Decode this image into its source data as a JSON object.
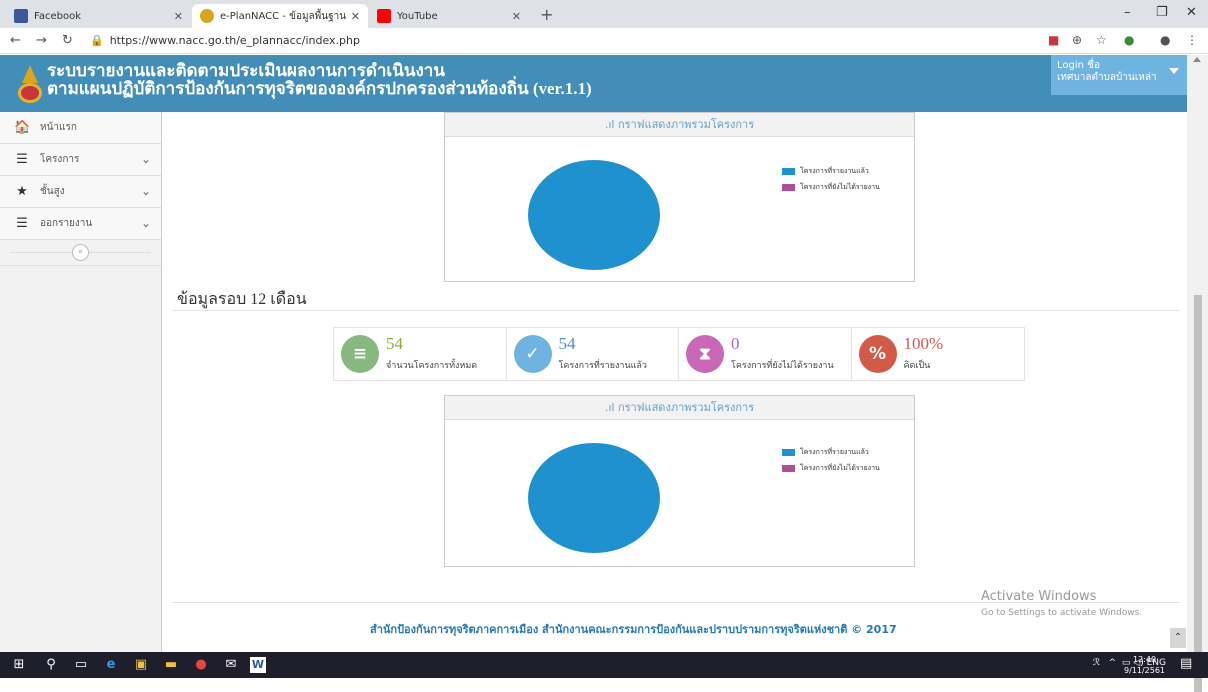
{
  "browser": {
    "tabs": [
      {
        "title": "Facebook",
        "favicon": "facebook-icon",
        "color": "#3b5998"
      },
      {
        "title": "e-PlanNACC - ข้อมูลพื้นฐาน",
        "favicon": "nacc-logo-icon",
        "color": "#d9a520"
      },
      {
        "title": "YouTube",
        "favicon": "youtube-icon",
        "color": "#ff0000"
      }
    ],
    "url": "https://www.nacc.go.th/e_plannacc/index.php",
    "new_tab": "+"
  },
  "header": {
    "title_line1": "ระบบรายงานและติดตามประเมินผลงานการดำเนินงาน",
    "title_line2": "ตามแผนปฏิบัติการป้องกันการทุจริตขององค์กรปกครองส่วนท้องถิ่น (ver.1.1)",
    "login_label": "Login ชื่อ",
    "login_user": "เทศบาลตำบลบ้านเหล่า",
    "color": "#438eb9"
  },
  "sidebar": {
    "items": [
      {
        "label": "หน้าแรก",
        "icon": "home-icon",
        "expandable": false
      },
      {
        "label": "โครงการ",
        "icon": "list-icon",
        "expandable": true
      },
      {
        "label": "ชั้นสูง",
        "icon": "star-icon",
        "expandable": true
      },
      {
        "label": "ออกรายงาน",
        "icon": "list-icon",
        "expandable": true
      }
    ],
    "collapse": "«"
  },
  "chart_widget_1": {
    "heading": "กราฟแสดงภาพรวมโครงการ"
  },
  "section": {
    "title": "ข้อมูลรอบ 12 เดือน"
  },
  "stats": [
    {
      "value": "54",
      "label": "จำนวนโครงการทั้งหมด",
      "icon": "database-icon",
      "color": "#87b87f",
      "numcolor": "#8bac3f"
    },
    {
      "value": "54",
      "label": "โครงการที่รายงานแล้ว",
      "icon": "check-icon",
      "color": "#6fb3e0",
      "numcolor": "#478fca"
    },
    {
      "value": "0",
      "label": "โครงการที่ยังไม่ได้รายงาน",
      "icon": "hourglass-icon",
      "color": "#c868b7",
      "numcolor": "#a069c3"
    },
    {
      "value": "100%",
      "label": "คิดเป็น",
      "icon": "percent-icon",
      "color": "#d15b47",
      "numcolor": "#d15b47"
    }
  ],
  "chart_widget_2": {
    "heading": "กราฟแสดงภาพรวมโครงการ"
  },
  "chart_data": [
    {
      "type": "pie",
      "title": "กราฟแสดงภาพรวมโครงการ",
      "categories": [
        "โครงการที่รายงานแล้ว",
        "โครงการที่ยังไม่ได้รายงาน"
      ],
      "values": [
        54,
        0
      ],
      "colors": [
        "#2091cf",
        "#af4e96"
      ],
      "legend": "top-right"
    },
    {
      "type": "pie",
      "title": "กราฟแสดงภาพรวมโครงการ",
      "categories": [
        "โครงการที่รายงานแล้ว",
        "โครงการที่ยังไม่ได้รายงาน"
      ],
      "values": [
        54,
        0
      ],
      "colors": [
        "#2091cf",
        "#af4e96"
      ],
      "legend": "top-right"
    }
  ],
  "watermark": {
    "line1": "Activate Windows",
    "line2": "Go to Settings to activate Windows."
  },
  "footer": {
    "text": "สำนักป้องกันการทุจริตภาคการเมือง สำนักงานคณะกรรมการป้องกันและปราบปรามการทุจริตแห่งชาติ © 2017"
  },
  "taskbar": {
    "lang": "ENG",
    "time": "12:40",
    "date": "9/11/2561"
  }
}
